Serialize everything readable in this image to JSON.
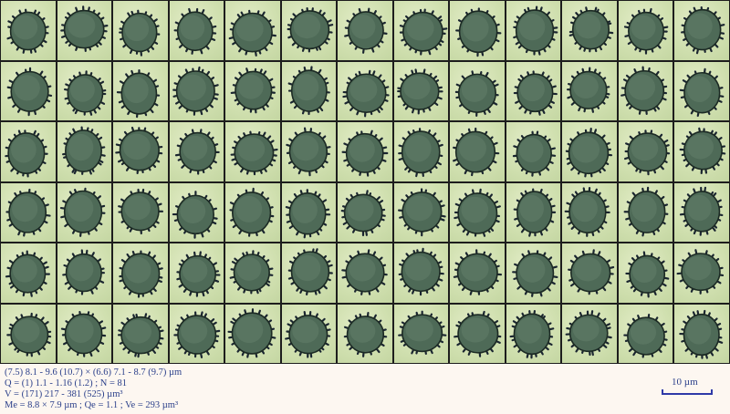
{
  "figure": {
    "grid": {
      "columns": 13,
      "rows": 6,
      "subject": "spore"
    },
    "colors": {
      "background": "#cfdfae",
      "spore_fill": "#4e6a57",
      "spore_edge": "#1c2a24",
      "spine": "#1a2530",
      "text": "#2a3f8a",
      "scale_bar": "#2f3aa8"
    }
  },
  "caption": {
    "line1": "(7.5) 8.1 - 9.6 (10.7) × (6.6) 7.1 - 8.7 (9.7) µm",
    "line2": "Q = (1) 1.1 - 1.16 (1.2) ; N = 81",
    "line3": "V = (171) 217 - 381 (525) µm³",
    "line4": "Me = 8.8 × 7.9 µm ; Qe = 1.1 ; Ve = 293 µm³"
  },
  "scale": {
    "label": "10 µm"
  }
}
